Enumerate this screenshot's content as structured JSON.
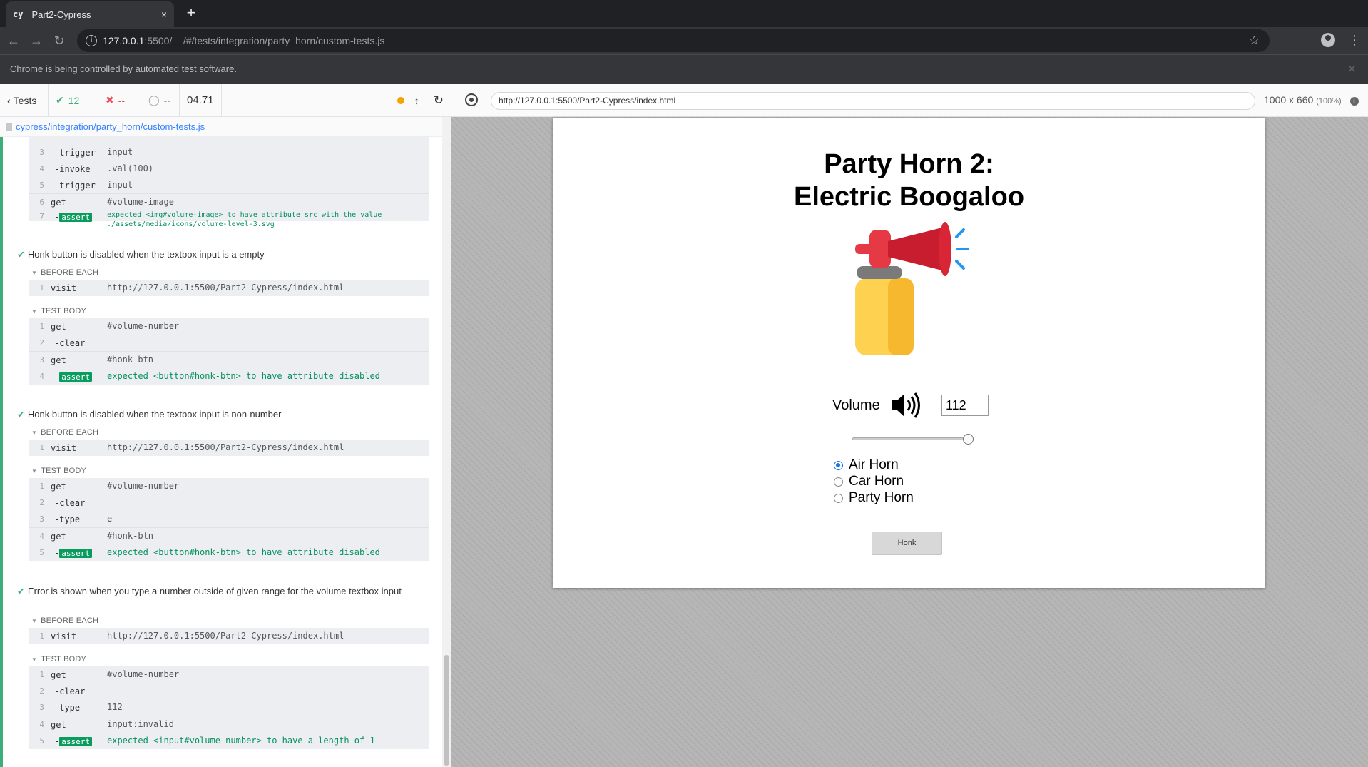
{
  "browser": {
    "tab_favicon": "cy",
    "tab_title": "Part2-Cypress",
    "tab_close": "×",
    "new_tab": "+",
    "url_host": "127.0.0.1",
    "url_rest": ":5500/__/#/tests/integration/party_horn/custom-tests.js",
    "infobar_message": "Chrome is being controlled by automated test software.",
    "icons": [
      "back-arrow-icon",
      "forward-arrow-icon",
      "reload-icon",
      "info-icon",
      "star-icon",
      "profile-icon",
      "menu-icon",
      "close-icon"
    ]
  },
  "reporter": {
    "tests_label": "Tests",
    "passed": "12",
    "failed": "--",
    "pending": "--",
    "duration": "04.71",
    "spec_path": "cypress/integration/party_horn/custom-tests.js",
    "colors": {
      "pass": "#3dae7a",
      "fail": "#e94f5f",
      "running_dot": "#f4a300",
      "assert": "#0a9b5e",
      "link": "#3380FF"
    },
    "prev_test_commands": [
      {
        "num": "3",
        "name": "-trigger",
        "msg": "input"
      },
      {
        "num": "4",
        "name": "-invoke",
        "msg": ".val(100)"
      },
      {
        "num": "5",
        "name": "-trigger",
        "msg": "input"
      },
      {
        "num": "6",
        "name": "get",
        "msg": "#volume-image"
      },
      {
        "num": "7",
        "name": "-assert",
        "msg": "expected <img#volume-image> to have attribute src with the value ./assets/media/icons/volume-level-3.svg"
      }
    ],
    "before_each_label": "BEFORE EACH",
    "test_body_label": "TEST BODY",
    "visit_url": "http://127.0.0.1:5500/Part2-Cypress/index.html",
    "tests": [
      {
        "title": "Honk button is disabled when the textbox input is a empty",
        "before": [
          {
            "num": "1",
            "name": "visit",
            "msg": "http://127.0.0.1:5500/Part2-Cypress/index.html"
          }
        ],
        "body": [
          {
            "num": "1",
            "name": "get",
            "msg": "#volume-number"
          },
          {
            "num": "2",
            "name": "-clear",
            "msg": ""
          },
          {
            "num": "3",
            "name": "get",
            "msg": "#honk-btn"
          },
          {
            "num": "4",
            "name": "-assert",
            "msg": "expected <button#honk-btn> to have attribute disabled"
          }
        ]
      },
      {
        "title": "Honk button is disabled when the textbox input is non-number",
        "before": [
          {
            "num": "1",
            "name": "visit",
            "msg": "http://127.0.0.1:5500/Part2-Cypress/index.html"
          }
        ],
        "body": [
          {
            "num": "1",
            "name": "get",
            "msg": "#volume-number"
          },
          {
            "num": "2",
            "name": "-clear",
            "msg": ""
          },
          {
            "num": "3",
            "name": "-type",
            "msg": "e"
          },
          {
            "num": "4",
            "name": "get",
            "msg": "#honk-btn"
          },
          {
            "num": "5",
            "name": "-assert",
            "msg": "expected <button#honk-btn> to have attribute disabled"
          }
        ]
      },
      {
        "title": "Error is shown when you type a number outside of given range for the volume textbox input",
        "before": [
          {
            "num": "1",
            "name": "visit",
            "msg": "http://127.0.0.1:5500/Part2-Cypress/index.html"
          }
        ],
        "body": [
          {
            "num": "1",
            "name": "get",
            "msg": "#volume-number"
          },
          {
            "num": "2",
            "name": "-clear",
            "msg": ""
          },
          {
            "num": "3",
            "name": "-type",
            "msg": "112"
          },
          {
            "num": "4",
            "name": "get",
            "msg": "input:invalid"
          },
          {
            "num": "5",
            "name": "-assert",
            "msg": "expected <input#volume-number> to have a length of 1"
          }
        ]
      }
    ]
  },
  "runner": {
    "aut_url": "http://127.0.0.1:5500/Part2-Cypress/index.html",
    "viewport": "1000 x 660",
    "viewport_pct": "(100%)"
  },
  "app": {
    "title_line1": "Party Horn 2:",
    "title_line2": "Electric Boogaloo",
    "image": "air-horn-image",
    "volume_label": "Volume",
    "volume_icon": "speaker-volume-icon",
    "volume_value": "112",
    "slider_level_percent": 100,
    "radios": [
      {
        "label": "Air Horn",
        "checked": true
      },
      {
        "label": "Car Horn",
        "checked": false
      },
      {
        "label": "Party Horn",
        "checked": false
      }
    ],
    "honk_label": "Honk"
  }
}
